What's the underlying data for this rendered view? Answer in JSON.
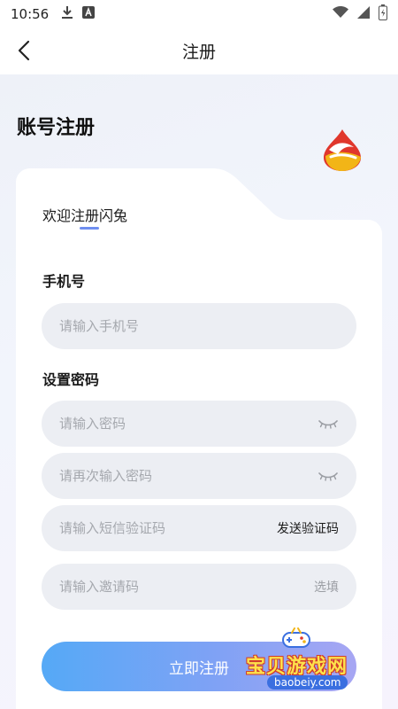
{
  "status_bar": {
    "time": "10:56",
    "icons_left": [
      "download-icon",
      "font-a-icon"
    ],
    "icons_right": [
      "wifi-icon",
      "signal-icon",
      "battery-icon"
    ]
  },
  "nav": {
    "title": "注册",
    "back_icon": "chevron-left-icon"
  },
  "page": {
    "heading": "账号注册",
    "welcome": "欢迎注册闪兔"
  },
  "form": {
    "phone_label": "手机号",
    "phone_placeholder": "请输入手机号",
    "password_section_label": "设置密码",
    "password_placeholder": "请输入密码",
    "password_confirm_placeholder": "请再次输入密码",
    "sms_placeholder": "请输入短信验证码",
    "send_code_label": "发送验证码",
    "invite_placeholder": "请输入邀请码",
    "invite_hint": "选填"
  },
  "submit_label": "立即注册",
  "watermark": {
    "title": "宝贝游戏网",
    "url": "baobeiy.com"
  },
  "colors": {
    "accent_blue": "#55a9f6",
    "accent_purple": "#a7a6f3",
    "field_bg": "#eceef3",
    "placeholder": "#a5a8ae",
    "logo_red": "#e0372c",
    "logo_yellow": "#f2b517"
  }
}
